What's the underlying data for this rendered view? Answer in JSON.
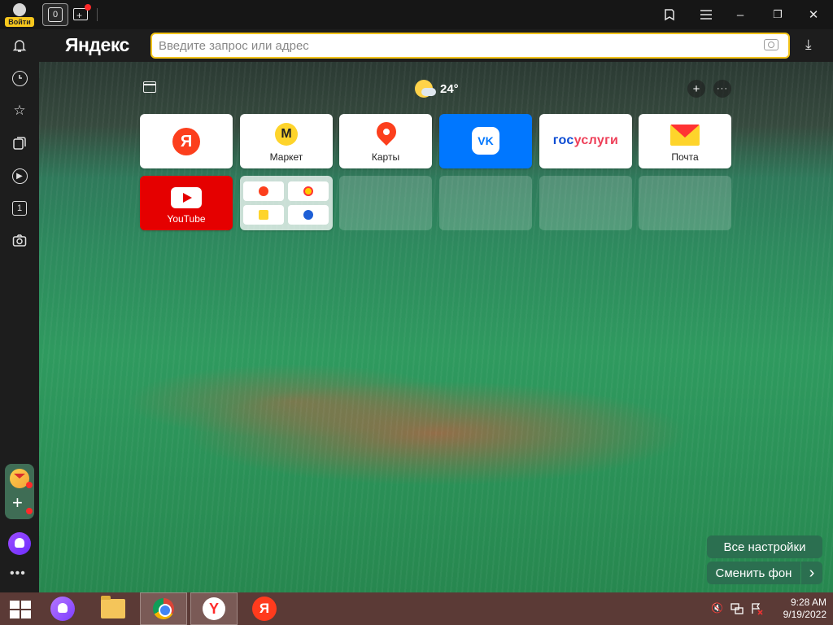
{
  "titlebar": {
    "login_label": "Войти",
    "home_tab_count": "0",
    "controls": {
      "bookmarks_icon": "bookmark-icon",
      "menu_icon": "hamburger-icon",
      "minimize": "–",
      "restore": "❐",
      "close": "✕"
    }
  },
  "addressbar": {
    "brand": "Яндекс",
    "placeholder": "Введите запрос или адрес",
    "download_icon": "⤓"
  },
  "sidebar": {
    "icons": [
      "bell-icon",
      "history-icon",
      "star-icon",
      "collections-icon",
      "play-icon",
      "tab-count-icon",
      "screenshot-icon"
    ],
    "tab_count": "1"
  },
  "newtab": {
    "weather_temp": "24°",
    "add_label": "+",
    "more_label": "···",
    "tiles": [
      {
        "name": "Яндекс",
        "caption": ""
      },
      {
        "name": "Маркет",
        "caption": "Маркет"
      },
      {
        "name": "Карты",
        "caption": "Карты"
      },
      {
        "name": "VK",
        "caption": ""
      },
      {
        "name": "Госуслуги",
        "logo_a": "гос",
        "logo_b": "услуги",
        "caption": ""
      },
      {
        "name": "Почта",
        "caption": "Почта"
      },
      {
        "name": "YouTube",
        "caption": "YouTube"
      }
    ],
    "buttons": {
      "all_settings": "Все настройки",
      "change_bg": "Сменить фон",
      "next": "›"
    }
  },
  "taskbar": {
    "apps": [
      "windows-start-icon",
      "alice-icon",
      "file-explorer-icon",
      "chrome-icon",
      "yandex-browser-icon",
      "yandex-icon"
    ],
    "time": "9:28 AM",
    "date": "9/19/2022"
  },
  "colors": {
    "accent": "#f3c41a",
    "vk": "#0077ff",
    "youtube": "#e50000",
    "yandex": "#fc3f1d"
  }
}
